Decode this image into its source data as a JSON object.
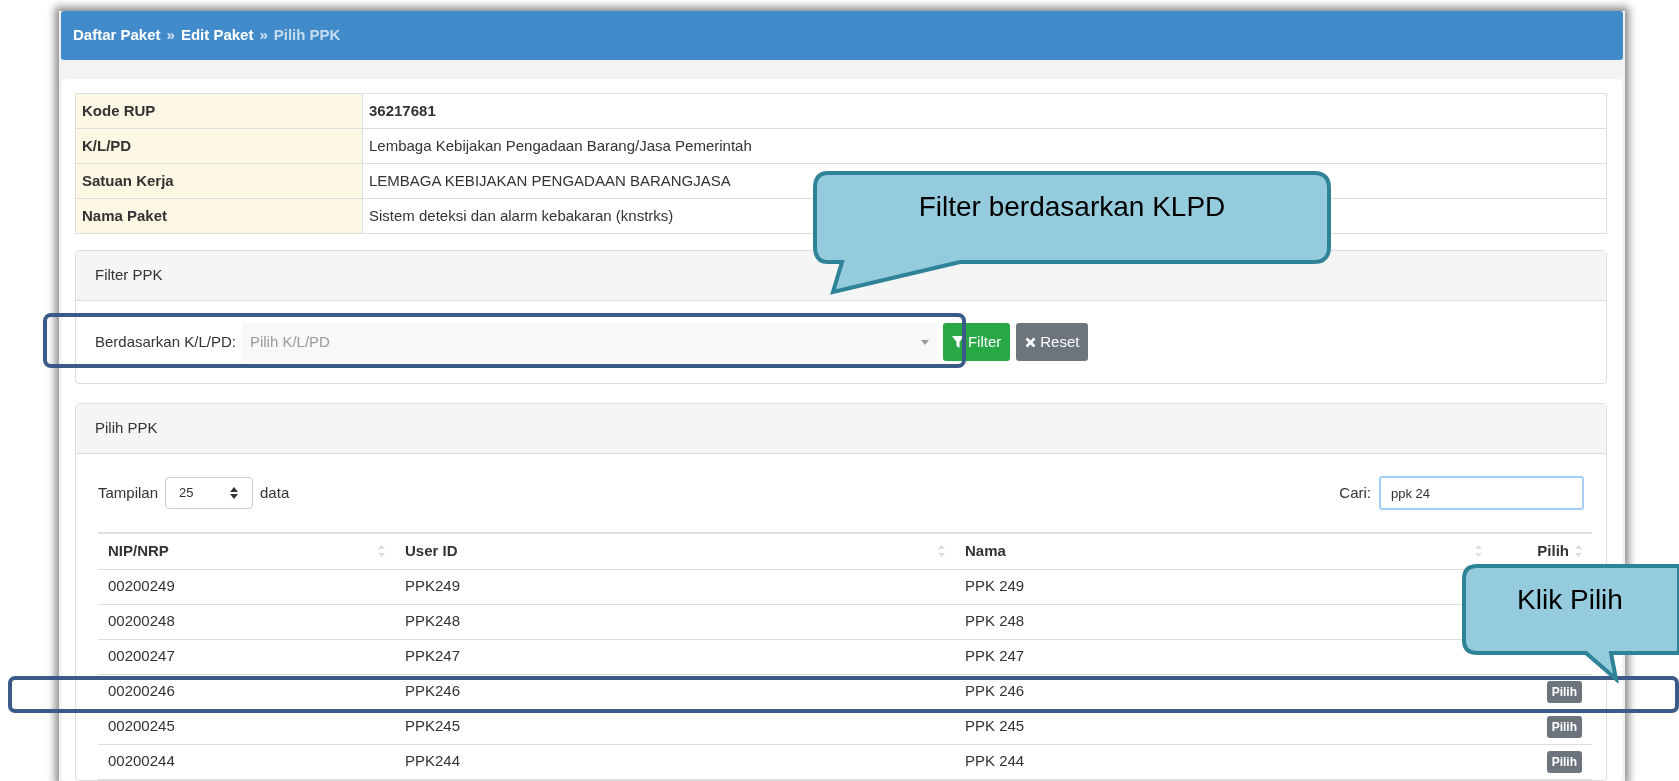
{
  "breadcrumb": [
    {
      "label": "Daftar Paket",
      "current": false
    },
    {
      "label": "Edit Paket",
      "current": false
    },
    {
      "label": "Pilih PPK",
      "current": true
    }
  ],
  "breadcrumb_separator": "»",
  "info": [
    {
      "label": "Kode RUP",
      "value": "36217681",
      "bold": true
    },
    {
      "label": "K/L/PD",
      "value": "Lembaga Kebijakan Pengadaan Barang/Jasa Pemerintah",
      "bold": false
    },
    {
      "label": "Satuan Kerja",
      "value": "LEMBAGA KEBIJAKAN PENGADAAN BARANGJASA",
      "bold": false
    },
    {
      "label": "Nama Paket",
      "value": "Sistem deteksi dan alarm kebakaran (knstrks)",
      "bold": false
    }
  ],
  "filter_panel": {
    "title": "Filter PPK",
    "label": "Berdasarkan K/L/PD:",
    "placeholder": "Pilih K/L/PD",
    "buttons": [
      {
        "kind": "filter",
        "label": "Filter"
      },
      {
        "kind": "reset",
        "label": "Reset"
      }
    ]
  },
  "pick_panel": {
    "title": "Pilih PPK",
    "length_label": "Tampilan",
    "length_value": "25",
    "length_suffix": "data",
    "search_label": "Cari:",
    "search_value": "ppk 24"
  },
  "table": {
    "columns": [
      "NIP/NRP",
      "User ID",
      "Nama",
      "Pilih"
    ],
    "rows": [
      {
        "cells": [
          "00200249",
          "PPK249",
          "PPK 249"
        ]
      },
      {
        "cells": [
          "00200248",
          "PPK248",
          "PPK 248"
        ]
      },
      {
        "cells": [
          "00200247",
          "PPK247",
          "PPK 247"
        ]
      },
      {
        "cells": [
          "00200246",
          "PPK246",
          "PPK 246"
        ],
        "button": "Pilih"
      },
      {
        "cells": [
          "00200245",
          "PPK245",
          "PPK 245"
        ],
        "button": "Pilih"
      },
      {
        "cells": [
          "00200244",
          "PPK244",
          "PPK 244"
        ],
        "button": "Pilih"
      }
    ]
  },
  "annotations": [
    {
      "kind": "callout",
      "text": "Filter berdasarkan KLPD"
    },
    {
      "kind": "callout",
      "text": "Klik Pilih"
    }
  ]
}
